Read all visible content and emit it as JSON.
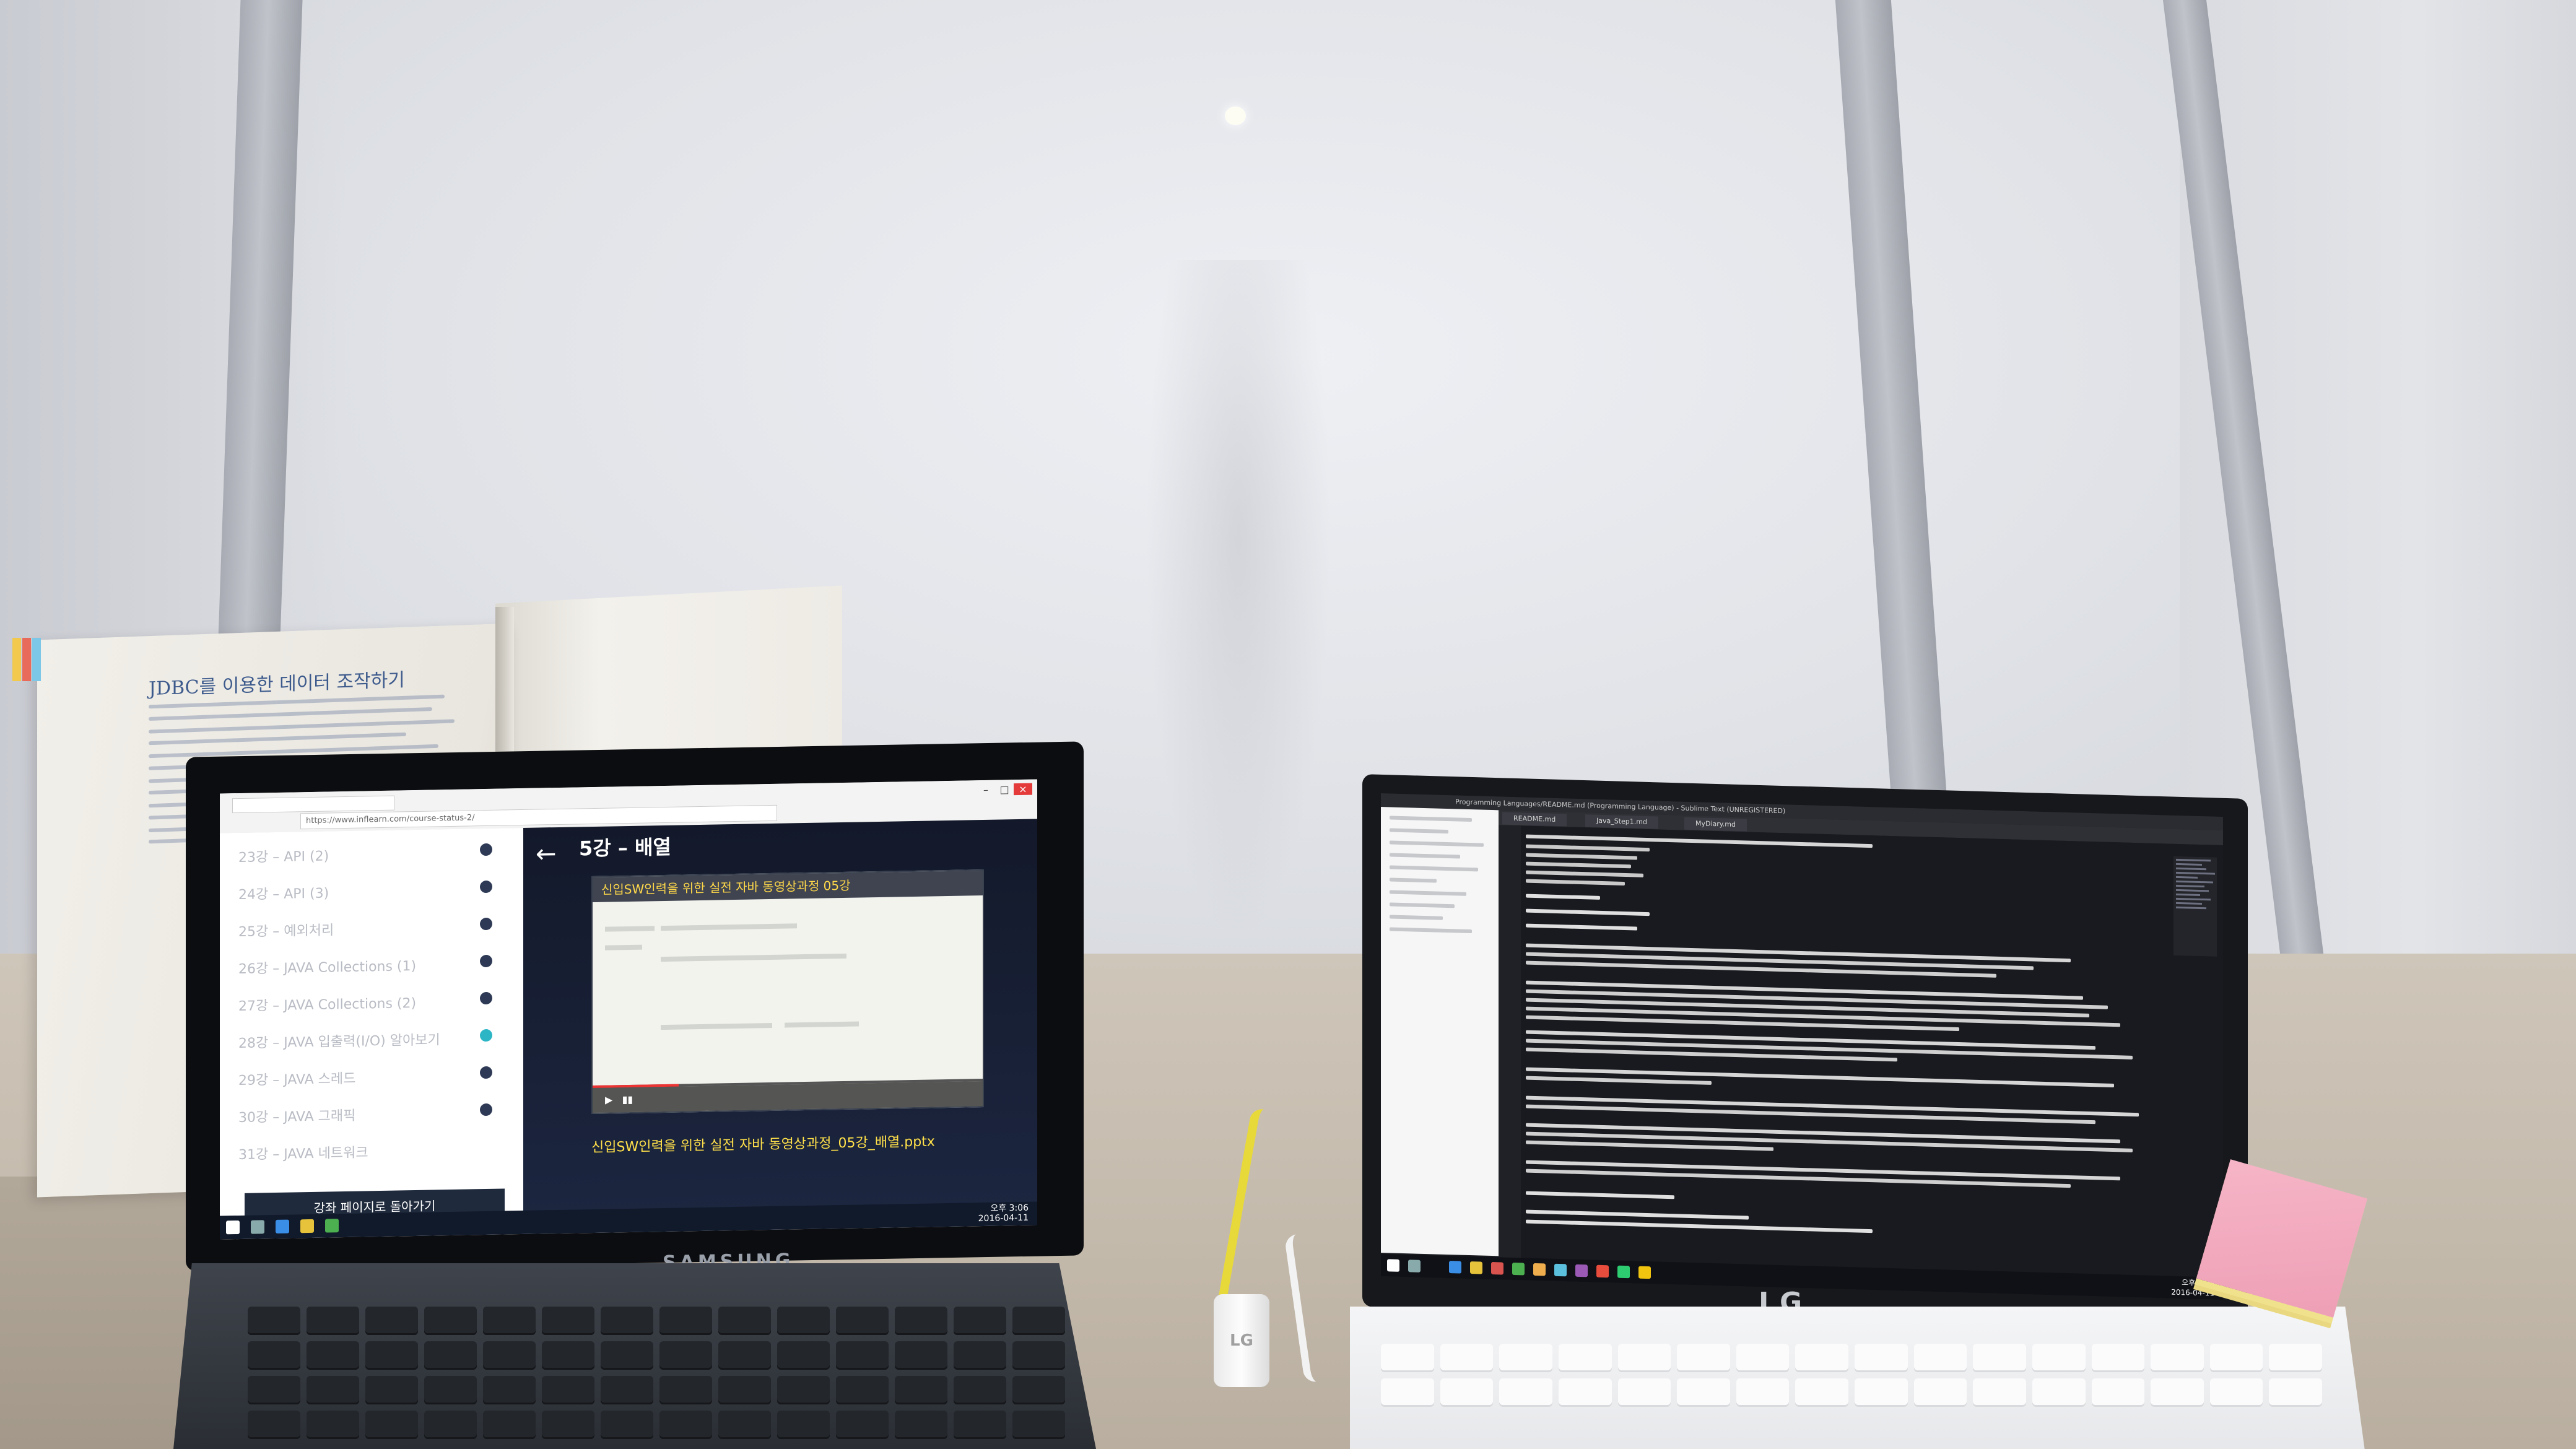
{
  "book": {
    "heading": "JDBC를 이용한 데이터 조작하기"
  },
  "samsung_laptop": {
    "brand": "SAMSUNG",
    "browser": {
      "url": "https://www.inflearn.com/course-status-2/"
    },
    "course_list": [
      {
        "label": "23강 – API (2)",
        "active": false
      },
      {
        "label": "24강 – API (3)",
        "active": false
      },
      {
        "label": "25강 – 예외처리",
        "active": false
      },
      {
        "label": "26강 – JAVA Collections (1)",
        "active": false
      },
      {
        "label": "27강 – JAVA Collections (2)",
        "active": false
      },
      {
        "label": "28강 – JAVA 입출력(I/O) 알아보기",
        "active": true
      },
      {
        "label": "29강 – JAVA 스레드",
        "active": false
      },
      {
        "label": "30강 – JAVA 그래픽",
        "active": false
      },
      {
        "label": "31강 – JAVA 네트워크",
        "active": false
      }
    ],
    "outline_button": "강좌 페이지로 돌아가기",
    "lesson_title": "5강 – 배열",
    "video_caption": "신입SW인력을 위한 실전 자바 동영상과정 05강",
    "file_link": "신입SW인력을 위한 실전 자바 동영상과정_05강_배열.pptx",
    "clock_time": "오후 3:06",
    "clock_date": "2016-04-11"
  },
  "lg_laptop": {
    "brand": "LG",
    "ide_title": "Programming Languages/README.md (Programming Language) - Sublime Text (UNREGISTERED)",
    "tabs": [
      "README.md",
      "Java_Step1.md",
      "MyDiary.md"
    ],
    "clock_time": "오후 3:06",
    "clock_date": "2016-04-11"
  },
  "usb_plug_label": "LG"
}
